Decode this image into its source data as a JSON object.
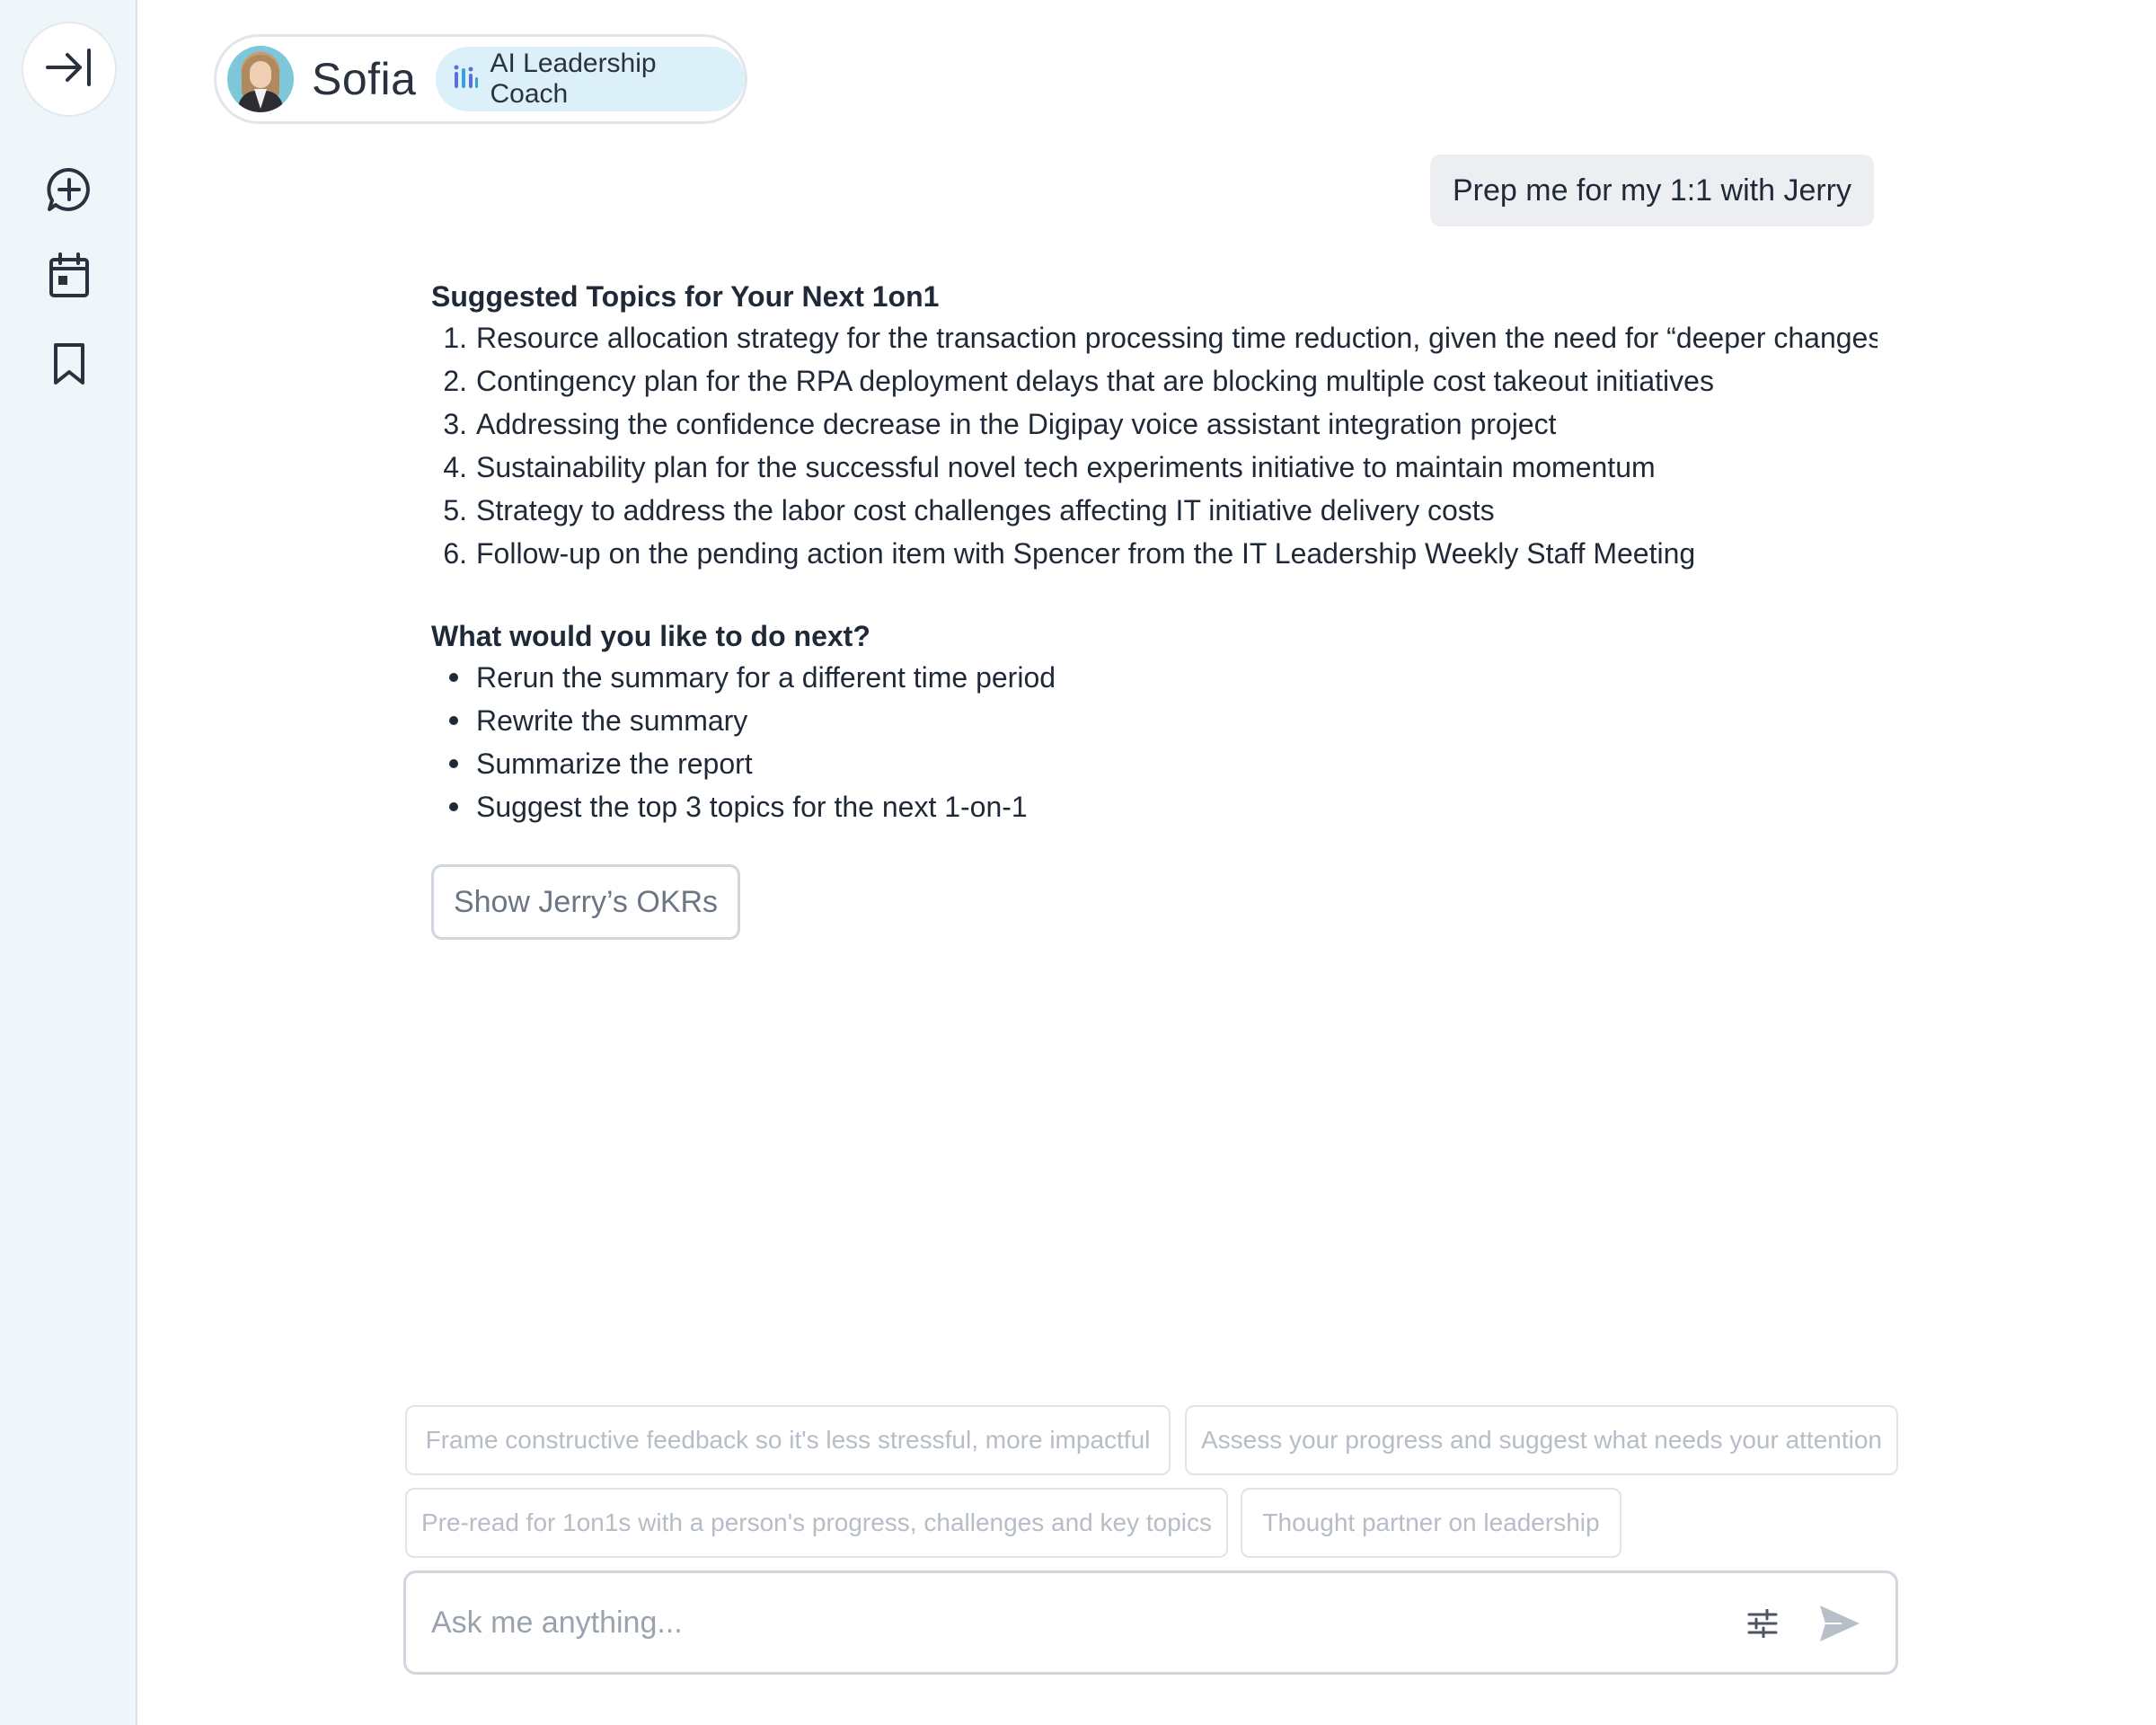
{
  "sidebar": {
    "collapse_icon": "collapse-right-icon",
    "items": [
      {
        "icon": "new-chat-icon"
      },
      {
        "icon": "calendar-icon"
      },
      {
        "icon": "bookmark-icon"
      }
    ]
  },
  "agent": {
    "name": "Sofia",
    "role": "AI Leadership Coach"
  },
  "conversation": {
    "user_message": "Prep me for my 1:1 with Jerry",
    "topics_title": "Suggested Topics for Your Next 1on1",
    "topics": [
      {
        "num": "1.",
        "text": "Resource allocation strategy for the transaction processing time reduction, given the need for “deeper changes"
      },
      {
        "num": "2.",
        "text": "Contingency plan for the RPA deployment delays that are blocking multiple cost takeout initiatives"
      },
      {
        "num": "3.",
        "text": "Addressing the confidence decrease in the Digipay voice assistant integration project"
      },
      {
        "num": "4.",
        "text": "Sustainability plan for the successful novel tech experiments initiative to maintain momentum"
      },
      {
        "num": "5.",
        "text": "Strategy to address the labor cost challenges affecting IT initiative delivery costs"
      },
      {
        "num": "6.",
        "text": "Follow-up on the pending action item with Spencer from the IT Leadership Weekly Staff Meeting"
      }
    ],
    "next_title": "What would you like to do next?",
    "next_options": [
      "Rerun the summary for a different time period",
      "Rewrite the summary",
      "Summarize the report",
      "Suggest the top 3 topics for the next 1-on-1"
    ],
    "okr_button": "Show Jerry’s OKRs"
  },
  "suggestions": [
    "Frame constructive feedback so it's less stressful, more impactful",
    "Assess your progress and suggest what needs your attention",
    "Pre-read for 1on1s with a person's progress, challenges and key topics",
    "Thought partner on leadership"
  ],
  "composer": {
    "placeholder": "Ask me anything...",
    "value": "",
    "settings_icon": "sliders-icon",
    "send_icon": "send-icon"
  },
  "colors": {
    "sidebar_bg": "#eef6f9",
    "badge_bg": "#dcf0fa",
    "user_bubble": "#eceef2",
    "text": "#1f2937",
    "muted": "#b6bdc6"
  }
}
